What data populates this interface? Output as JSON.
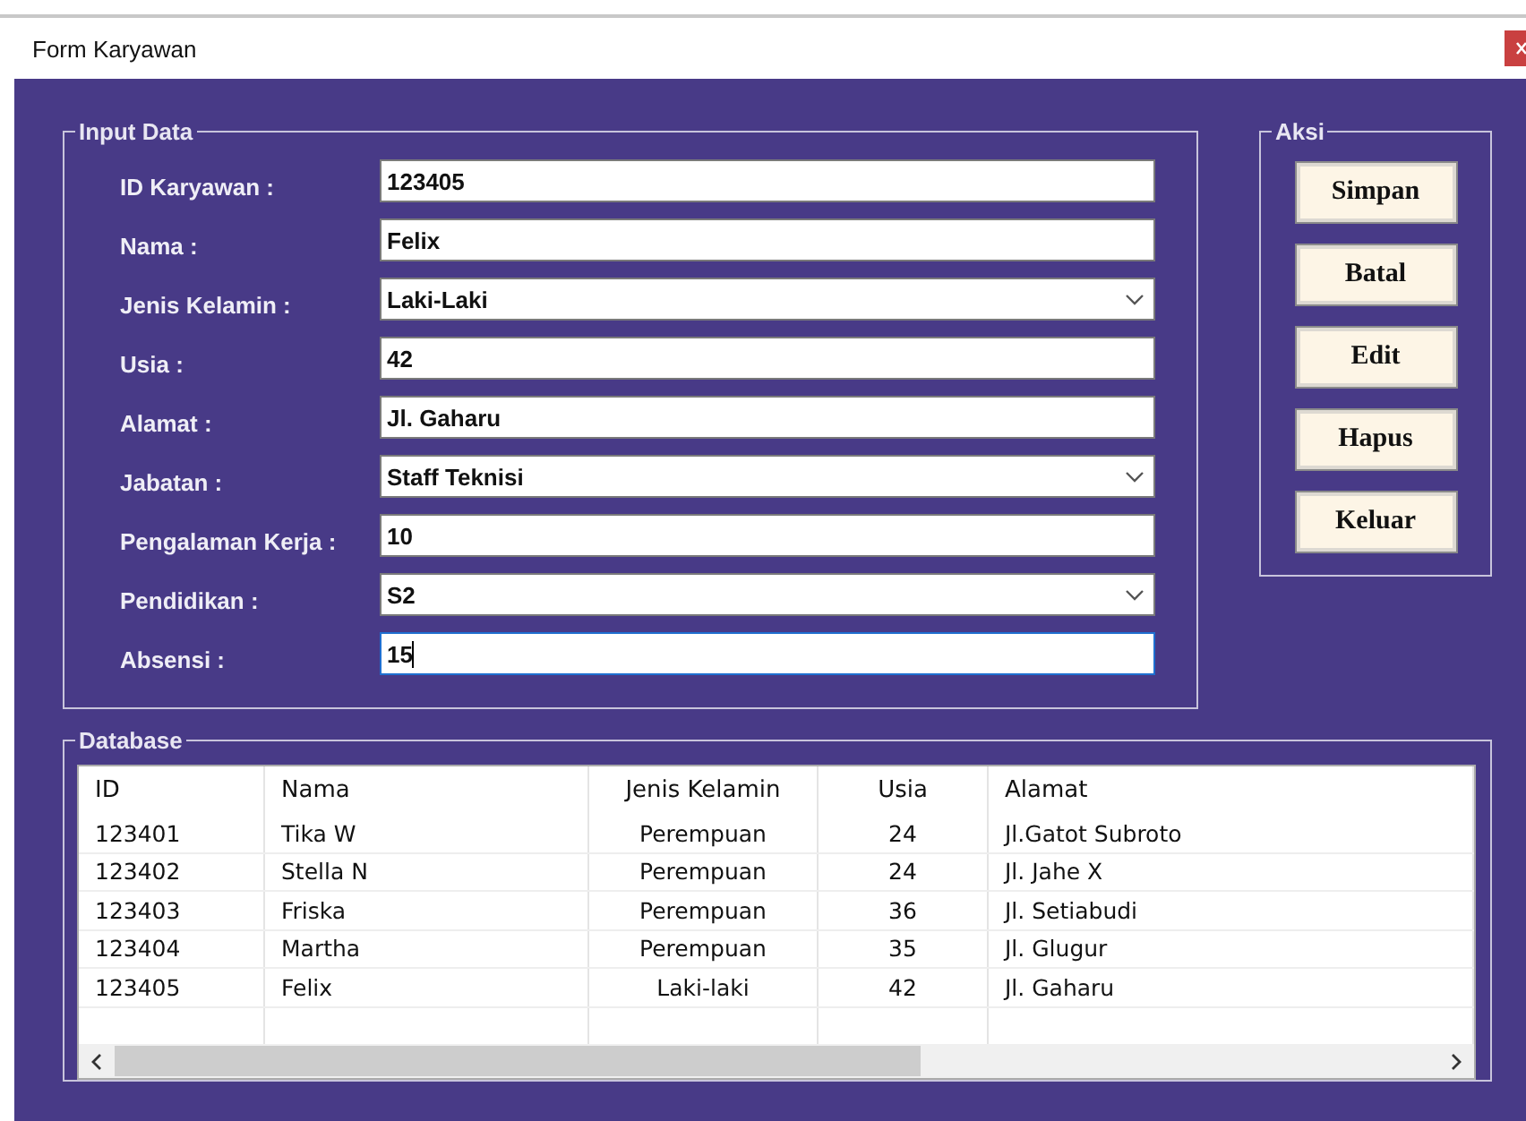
{
  "window": {
    "title": "Form Karyawan"
  },
  "input_data": {
    "title": "Input Data",
    "fields": [
      {
        "label": "ID Karyawan :",
        "kind": "text",
        "value": "123405",
        "focused": false
      },
      {
        "label": "Nama :",
        "kind": "text",
        "value": "Felix",
        "focused": false
      },
      {
        "label": "Jenis Kelamin :",
        "kind": "combo",
        "value": "Laki-Laki",
        "focused": false
      },
      {
        "label": "Usia :",
        "kind": "text",
        "value": "42",
        "focused": false
      },
      {
        "label": "Alamat :",
        "kind": "text",
        "value": "Jl. Gaharu",
        "focused": false
      },
      {
        "label": "Jabatan :",
        "kind": "combo",
        "value": "Staff Teknisi",
        "focused": false
      },
      {
        "label": "Pengalaman Kerja :",
        "kind": "text",
        "value": "10",
        "focused": false
      },
      {
        "label": "Pendidikan :",
        "kind": "combo",
        "value": "S2",
        "focused": false
      },
      {
        "label": "Absensi :",
        "kind": "text",
        "value": "15",
        "focused": true
      }
    ]
  },
  "aksi": {
    "title": "Aksi",
    "buttons": [
      "Simpan",
      "Batal",
      "Edit",
      "Hapus",
      "Keluar"
    ]
  },
  "database": {
    "title": "Database",
    "table": {
      "columns": [
        "ID",
        "Nama",
        "Jenis Kelamin",
        "Usia",
        "Alamat"
      ],
      "rows": [
        [
          "123401",
          "Tika W",
          "Perempuan",
          "24",
          "Jl.Gatot Subroto"
        ],
        [
          "123402",
          "Stella N",
          "Perempuan",
          "24",
          "Jl. Jahe X"
        ],
        [
          "123403",
          "Friska",
          "Perempuan",
          "36",
          "Jl. Setiabudi"
        ],
        [
          "123404",
          "Martha",
          "Perempuan",
          "35",
          "Jl. Glugur"
        ],
        [
          "123405",
          "Felix",
          "Laki-laki",
          "42",
          "Jl. Gaharu"
        ]
      ]
    }
  }
}
